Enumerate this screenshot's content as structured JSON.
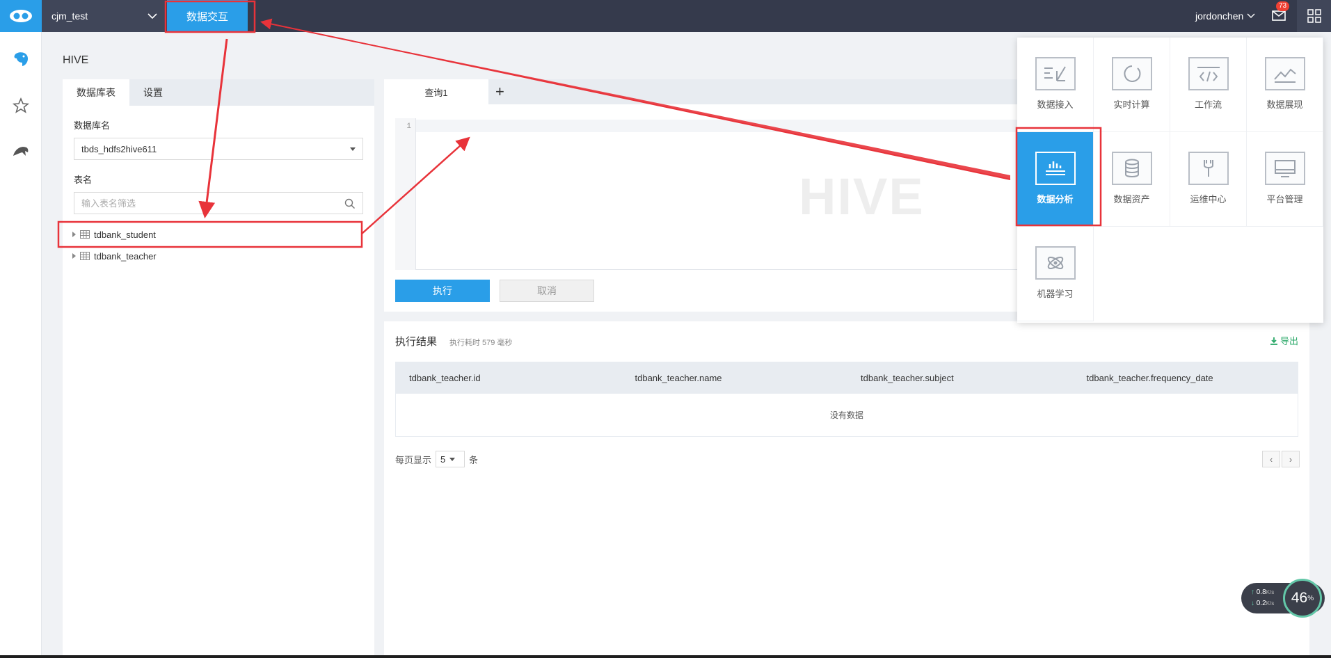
{
  "topbar": {
    "project_name": "cjm_test",
    "active_nav": "数据交互",
    "username": "jordonchen",
    "mail_badge": "73"
  },
  "breadcrumb": "HIVE",
  "left_panel": {
    "tabs": [
      "数据库表",
      "设置"
    ],
    "db_label": "数据库名",
    "db_selected": "tbds_hdfs2hive611",
    "table_label": "表名",
    "table_filter_placeholder": "输入表名筛选",
    "tables": [
      "tdbank_student",
      "tdbank_teacher"
    ]
  },
  "query": {
    "tab_label": "查询1",
    "add_tab": "+",
    "line_number": "1",
    "watermark": "HIVE",
    "execute_label": "执行",
    "cancel_label": "取消"
  },
  "results": {
    "title": "执行结果",
    "elapsed": "执行耗时 579 毫秒",
    "export_label": "导出",
    "columns": [
      "tdbank_teacher.id",
      "tdbank_teacher.name",
      "tdbank_teacher.subject",
      "tdbank_teacher.frequency_date"
    ],
    "empty_text": "没有数据",
    "page_size_prefix": "每页显示",
    "page_size": "5",
    "page_size_suffix": "条",
    "prev": "‹",
    "next": "›"
  },
  "app_menu": {
    "items": [
      {
        "label": "数据接入",
        "icon": "data-ingest-icon"
      },
      {
        "label": "实时计算",
        "icon": "realtime-compute-icon"
      },
      {
        "label": "工作流",
        "icon": "workflow-code-icon"
      },
      {
        "label": "数据展现",
        "icon": "line-chart-icon"
      },
      {
        "label": "数据分析",
        "icon": "bar-analysis-icon",
        "active": true
      },
      {
        "label": "数据资产",
        "icon": "database-icon"
      },
      {
        "label": "运维中心",
        "icon": "wrench-icon"
      },
      {
        "label": "平台管理",
        "icon": "monitor-icon"
      },
      {
        "label": "机器学习",
        "icon": "atom-icon"
      }
    ]
  },
  "speed_widget": {
    "up": "0.8",
    "down": "0.2",
    "unit": "K/s",
    "percent": "46",
    "percent_unit": "%"
  },
  "colors": {
    "topbar": "#353a4c",
    "accent": "#2a9ee8",
    "annotation": "#e8333a",
    "export": "#2aa868"
  }
}
